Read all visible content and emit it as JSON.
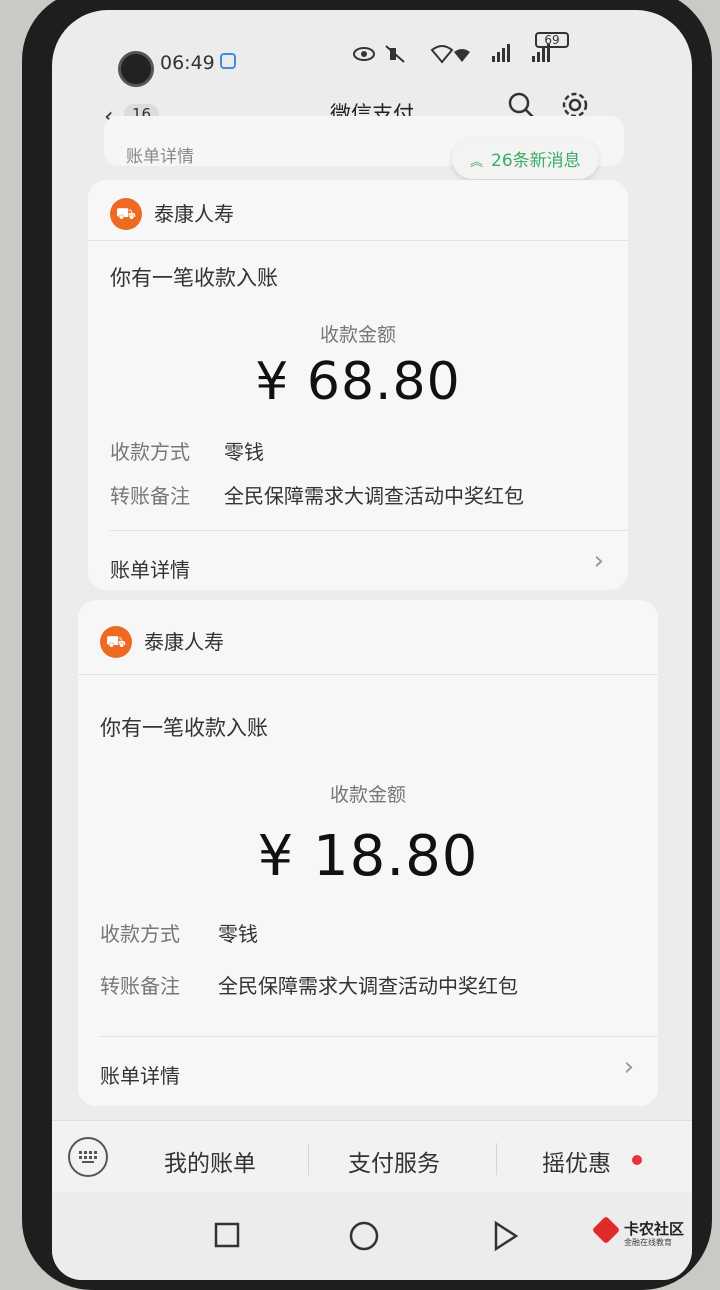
{
  "status_bar": {
    "time": "06:49",
    "battery": "69"
  },
  "nav": {
    "back_count": "16",
    "title": "微信支付"
  },
  "peek": {
    "text": "账单详情"
  },
  "new_messages": {
    "label": "26条新消息"
  },
  "cards": [
    {
      "merchant": "泰康人寿",
      "title": "你有一笔收款入账",
      "amount_label": "收款金额",
      "amount": "¥ 68.80",
      "rows": [
        {
          "label": "收款方式",
          "value": "零钱"
        },
        {
          "label": "转账备注",
          "value": "全民保障需求大调查活动中奖红包"
        }
      ],
      "detail": "账单详情"
    },
    {
      "merchant": "泰康人寿",
      "title": "你有一笔收款入账",
      "amount_label": "收款金额",
      "amount": "¥ 18.80",
      "rows": [
        {
          "label": "收款方式",
          "value": "零钱"
        },
        {
          "label": "转账备注",
          "value": "全民保障需求大调查活动中奖红包"
        }
      ],
      "detail": "账单详情"
    }
  ],
  "bottom_menu": {
    "items": [
      "我的账单",
      "支付服务",
      "摇优惠"
    ]
  },
  "watermark": {
    "title": "卡农社区",
    "subtitle": "金融在线教育"
  },
  "colors": {
    "accent_green": "#3cad62",
    "merchant_orange": "#ee6a22",
    "notify_red": "#e8323c"
  }
}
